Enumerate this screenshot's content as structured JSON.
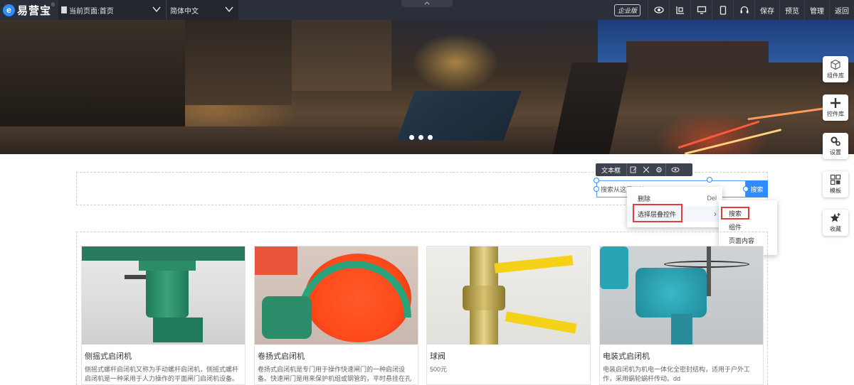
{
  "topbar": {
    "logo_mark": "e",
    "logo_text": "易营宝",
    "logo_sup": "®",
    "current_page": "当前页面:首页",
    "language": "简体中文",
    "enterprise_badge": "企业版",
    "save": "保存",
    "preview": "预览",
    "manage": "管理",
    "back": "返回"
  },
  "banner": {
    "grid_marks": [
      "b0d",
      "b0d",
      "b0d",
      "b0d",
      "b0d",
      "b0d",
      "b0d",
      "b0d",
      "b0d",
      "b0d",
      "b0d",
      "b0d"
    ]
  },
  "side_panel": [
    {
      "label": "组件库",
      "icon": "cube-icon"
    },
    {
      "label": "控件库",
      "icon": "plus-icon"
    },
    {
      "label": "设置",
      "icon": "gears-icon"
    },
    {
      "label": "模板",
      "icon": "template-icon"
    },
    {
      "label": "收藏",
      "icon": "star-icon"
    }
  ],
  "component_toolbar": {
    "label": "文本框"
  },
  "search": {
    "placeholder": "搜索从这里开始",
    "button": "搜索"
  },
  "context_menu": {
    "items": [
      {
        "label": "删除",
        "shortcut": "Del"
      },
      {
        "label": "选择层叠控件",
        "shortcut": "›"
      }
    ],
    "submenu": [
      "搜索",
      "组件",
      "页面内容"
    ]
  },
  "products": [
    {
      "title": "侧摇式启闭机",
      "desc": "侧摇式螺杆启闭机又称为手动螺杆启闭机，侧摇式螺杆启闭机是一种采用于人力操作的平面闸门启闭机设备。"
    },
    {
      "title": "卷扬式启闭机",
      "desc": "卷扬式启闭机是专门用于操作快速闸门的一种启闭设备。快速闸门是用来保护机组或钢管的，平时悬挂在孔口上..."
    },
    {
      "title": "球阀",
      "desc": "500元"
    },
    {
      "title": "电装式启闭机",
      "desc": "电装启闭机为机电一体化全密封结构，适用于户外工作，采用蜗轮蜗杆传动。dd"
    }
  ],
  "colors": {
    "toolbar_bg": "#2b2f3a",
    "accent": "#2f8cff",
    "highlight": "#e43c3c"
  }
}
